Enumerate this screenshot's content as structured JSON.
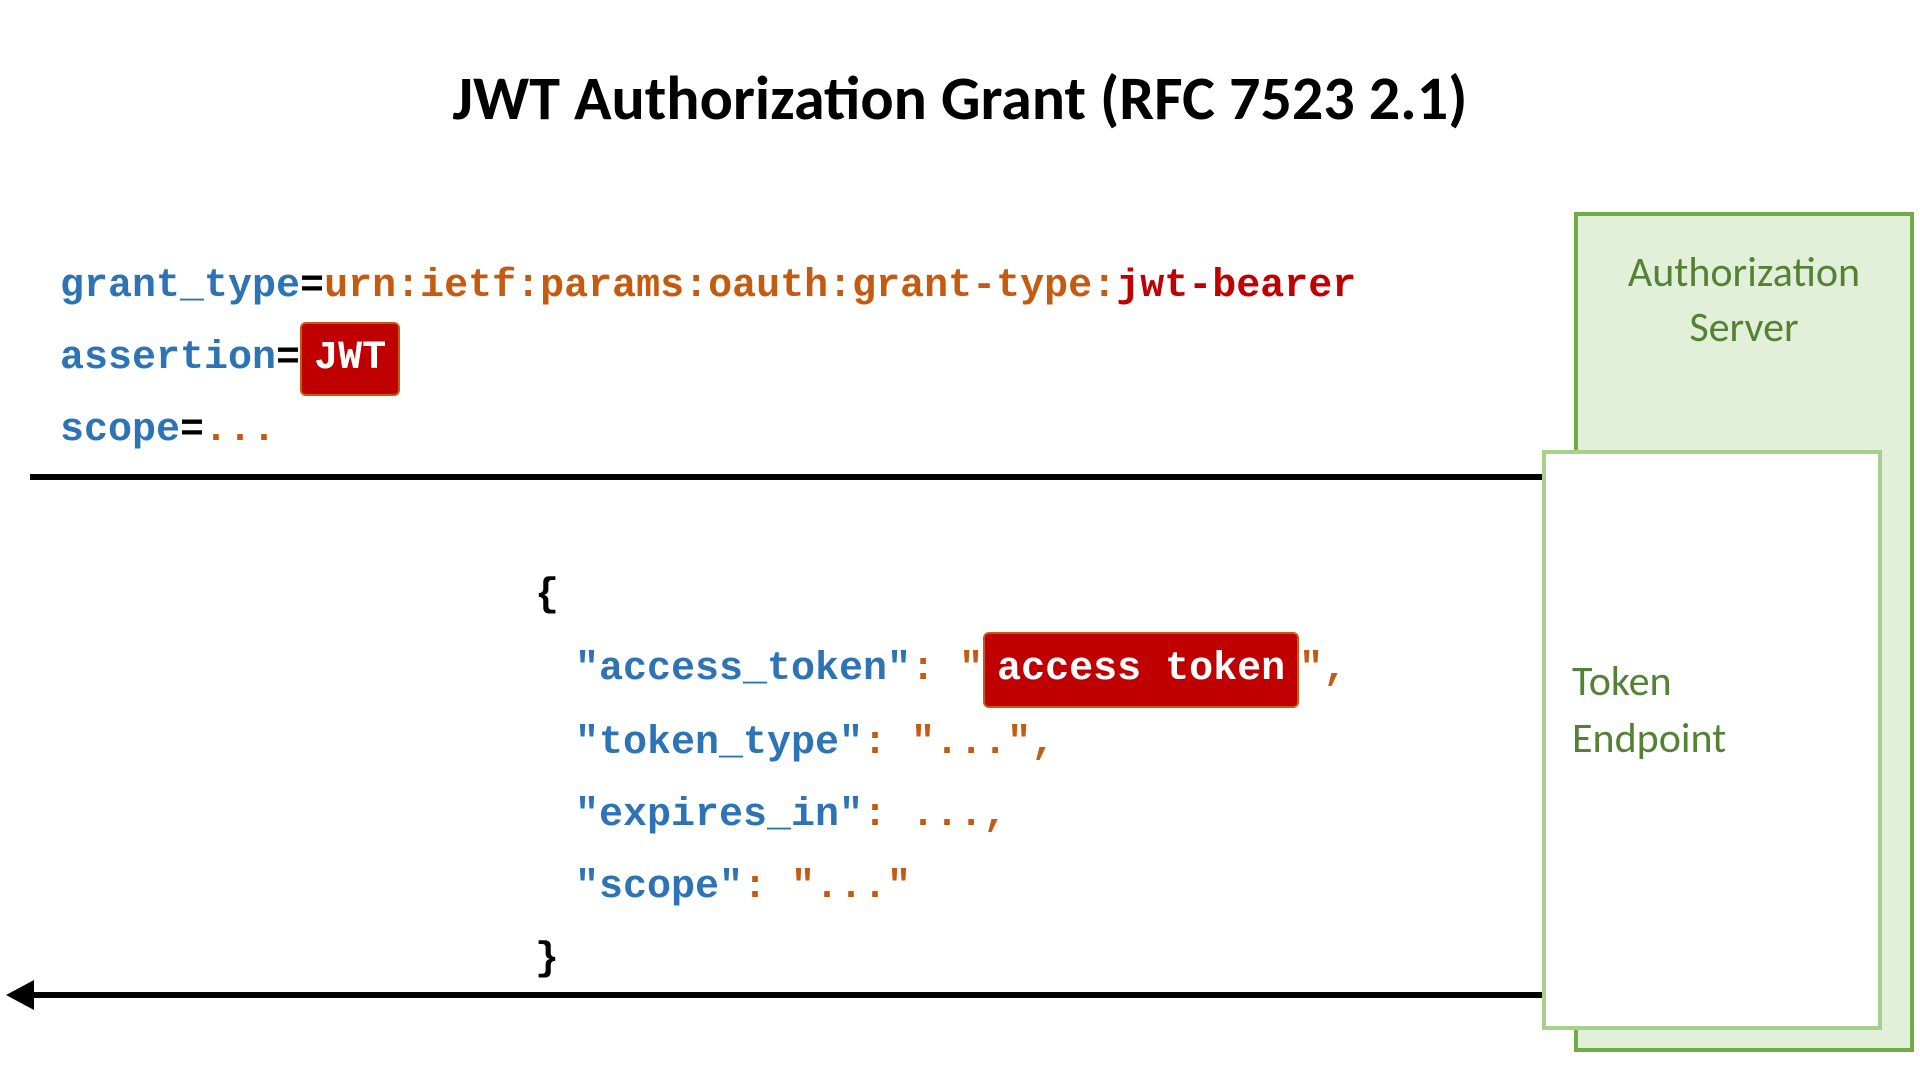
{
  "title": "JWT Authorization Grant (RFC 7523 2.1)",
  "request": {
    "grant_type_key": "grant_type",
    "eq": "=",
    "grant_type_prefix": "urn:ietf:params:oauth:grant-type:",
    "grant_type_suffix": "jwt-bearer",
    "assertion_key": "assertion",
    "jwt_badge": "JWT",
    "scope_key": "scope",
    "scope_value": "..."
  },
  "response": {
    "open_brace": "{",
    "close_brace": "}",
    "access_token_key": "\"access_token\"",
    "colon_space_quote": ": \"",
    "access_token_badge": "access token",
    "end_quote_comma": "\",",
    "token_type_line_key": "\"token_type\"",
    "token_type_line_val": ": \"...\",",
    "expires_in_key": "\"expires_in\"",
    "expires_in_val": ": ...,",
    "scope_key": "\"scope\"",
    "scope_val": ": \"...\""
  },
  "server_box": {
    "auth_server_l1": "Authorization",
    "auth_server_l2": "Server",
    "token_endpoint_l1": "Token",
    "token_endpoint_l2": "Endpoint"
  }
}
